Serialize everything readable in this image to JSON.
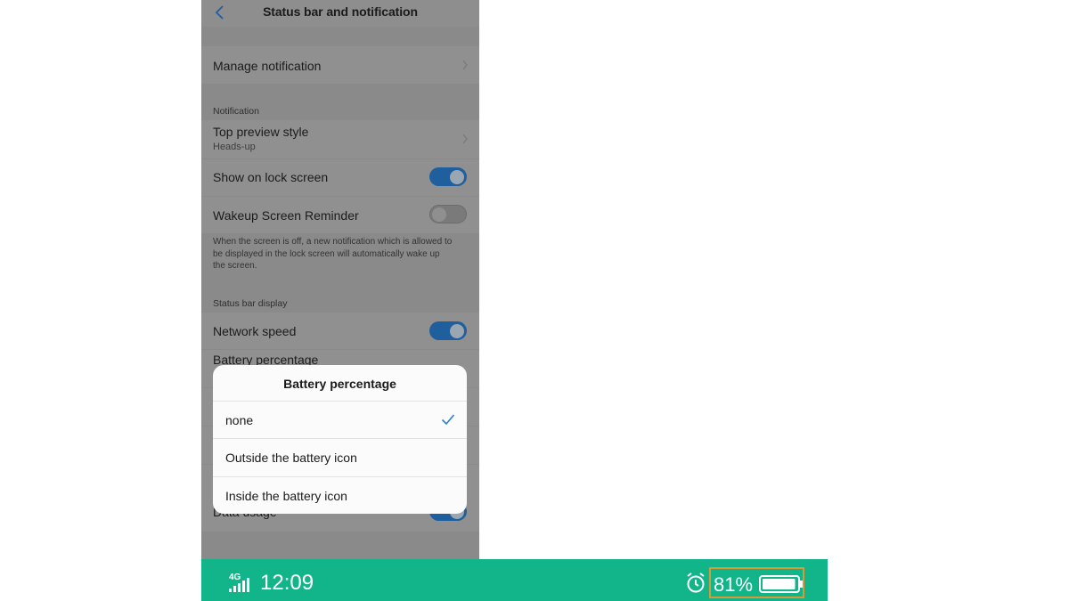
{
  "header": {
    "title": "Status bar and notification"
  },
  "items": {
    "manage_notification": "Manage notification",
    "notification_section": "Notification",
    "top_preview_style": "Top preview style",
    "top_preview_value": "Heads-up",
    "show_on_lock_screen": "Show on lock screen",
    "wakeup_screen_reminder": "Wakeup Screen Reminder",
    "wakeup_description": "When the screen is off, a new notification which is allowed to be displayed in the lock screen will automatically wake up the screen.",
    "status_bar_section": "Status bar display",
    "network_speed": "Network speed",
    "battery_percentage": "Battery percentage",
    "data_usage": "Data usage"
  },
  "toggles": {
    "show_on_lock_screen": true,
    "wakeup_screen_reminder": false,
    "network_speed": true,
    "data_usage": true
  },
  "dialog": {
    "title": "Battery percentage",
    "options": [
      "none",
      "Outside the battery icon",
      "Inside the battery icon"
    ],
    "selected": "none"
  },
  "statusbar": {
    "network": "4G",
    "time": "12:09",
    "battery_percent": "81%",
    "battery_level": 0.81,
    "icons": [
      "signal-icon",
      "alarm-icon",
      "battery-icon"
    ]
  },
  "colors": {
    "accent": "#1f5f9e",
    "statusbar_bg": "#12b58a",
    "highlight_box": "#d79a37"
  }
}
